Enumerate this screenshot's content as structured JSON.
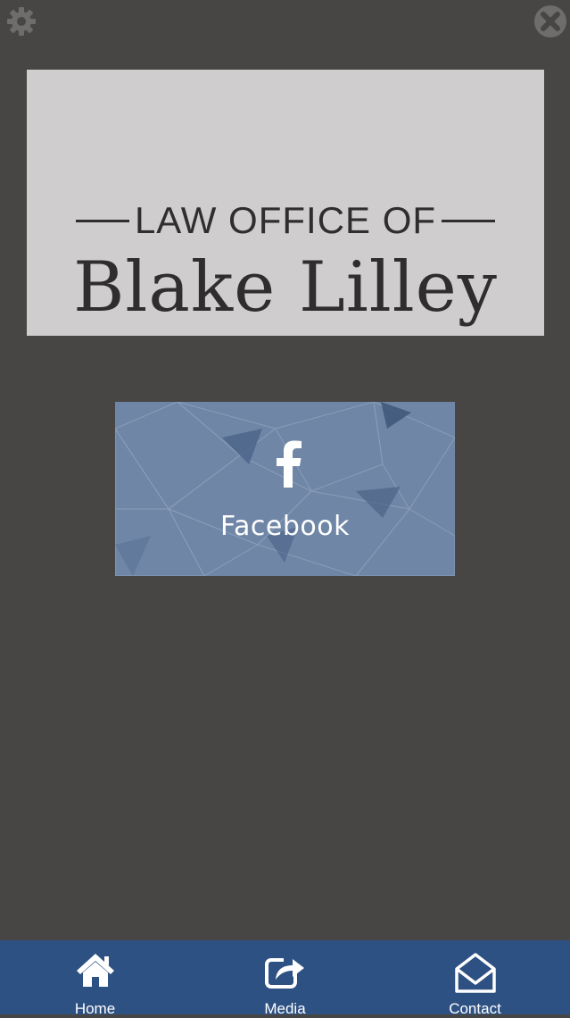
{
  "header": {
    "settings_icon": "gear-icon",
    "close_icon": "close-circle-icon"
  },
  "logo": {
    "line1": "LAW OFFICE OF",
    "line2": "Blake Lilley"
  },
  "social": {
    "label": "Facebook",
    "icon": "facebook-icon"
  },
  "tabbar": {
    "tabs": [
      {
        "label": "Home",
        "icon": "home-icon"
      },
      {
        "label": "Media",
        "icon": "share-icon"
      },
      {
        "label": "Contact",
        "icon": "envelope-icon"
      }
    ]
  },
  "colors": {
    "background": "#484645",
    "tabbar": "#2e5183",
    "logo_bg": "#cfcdcd",
    "card": "#6f86a6"
  }
}
